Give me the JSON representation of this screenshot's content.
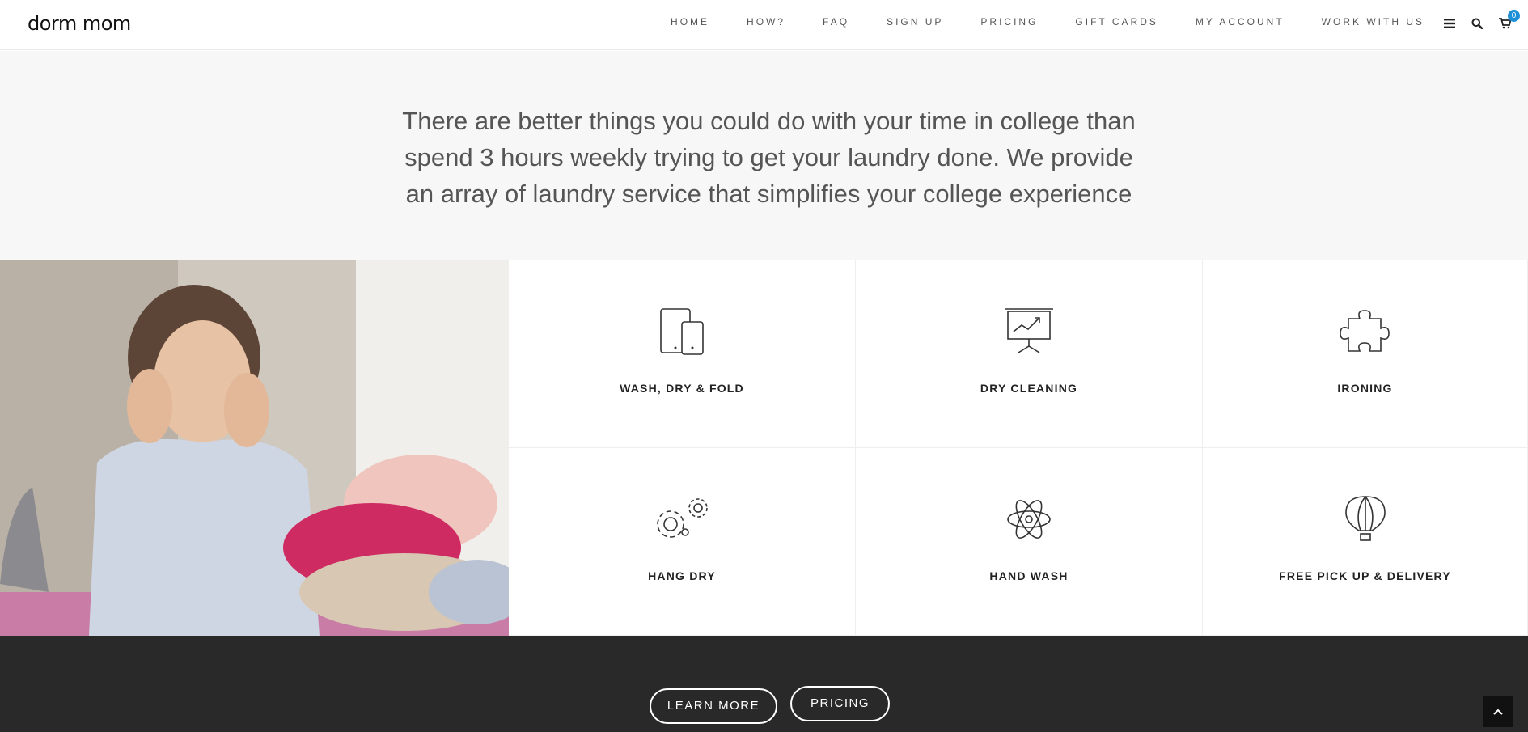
{
  "header": {
    "logo": "dorm mom",
    "nav": [
      "HOME",
      "HOW?",
      "FAQ",
      "SIGN UP",
      "PRICING",
      "GIFT CARDS",
      "MY ACCOUNT",
      "WORK WITH US"
    ],
    "icons": [
      "menu-icon",
      "search-icon",
      "cart-icon"
    ],
    "cart_count": "0",
    "badge_color": "#1e8fd6"
  },
  "intro": {
    "text": "There are better things you could do with your time in college than spend 3 hours weekly trying to get your laundry done. We provide an array of laundry service that simplifies your college experience"
  },
  "services": [
    {
      "label": "WASH, DRY & FOLD",
      "icon": "devices-icon"
    },
    {
      "label": "DRY CLEANING",
      "icon": "presentation-chart-icon"
    },
    {
      "label": "IRONING",
      "icon": "puzzle-piece-icon"
    },
    {
      "label": "HANG DRY",
      "icon": "gears-icon"
    },
    {
      "label": "HAND WASH",
      "icon": "atom-icon"
    },
    {
      "label": "FREE PICK UP & DELIVERY",
      "icon": "hot-air-balloon-icon"
    }
  ],
  "footer": {
    "learn_more": "LEARN MORE",
    "pricing": "PRICING"
  }
}
